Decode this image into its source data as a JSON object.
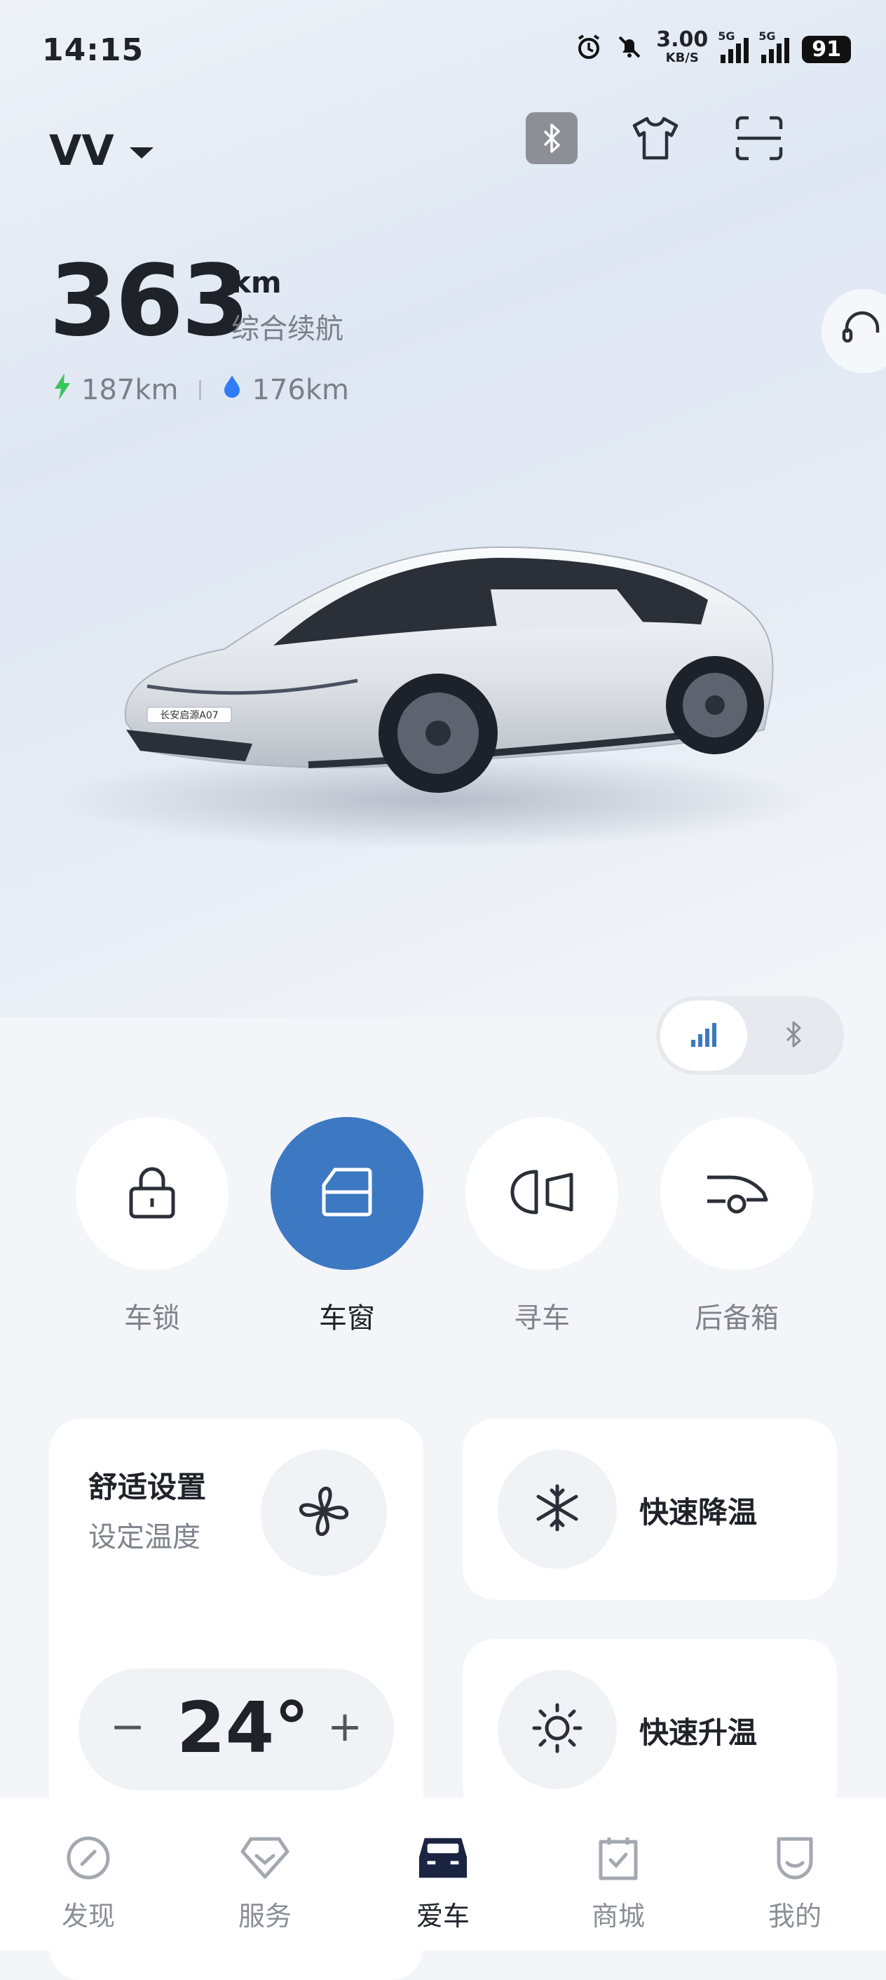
{
  "status_bar": {
    "time": "14:15",
    "net_rate": "3.00",
    "net_unit": "KB/S",
    "sim1": "5G",
    "sim2": "5G",
    "battery": "91"
  },
  "header": {
    "vehicle_name": "VV",
    "icons": [
      "bluetooth-icon",
      "shirt-icon",
      "scan-icon"
    ]
  },
  "range": {
    "value": "363",
    "unit": "km",
    "label": "综合续航",
    "electric": "187km",
    "fuel": "176km"
  },
  "car_image": {
    "plate_text": "长安启源A07"
  },
  "controls": [
    {
      "label": "车锁",
      "icon": "lock-icon",
      "active": false
    },
    {
      "label": "车窗",
      "icon": "window-icon",
      "active": true
    },
    {
      "label": "寻车",
      "icon": "headlight-icon",
      "active": false
    },
    {
      "label": "后备箱",
      "icon": "trunk-icon",
      "active": false
    }
  ],
  "comfort": {
    "title": "舒适设置",
    "subtitle": "设定温度",
    "minus": "−",
    "temperature": "24°",
    "plus": "+"
  },
  "quick_cool": {
    "label": "快速降温"
  },
  "quick_heat": {
    "label": "快速升温"
  },
  "tabs": [
    {
      "label": "发现",
      "icon": "discover-icon"
    },
    {
      "label": "服务",
      "icon": "service-icon"
    },
    {
      "label": "爱车",
      "icon": "car-icon",
      "active": true
    },
    {
      "label": "商城",
      "icon": "mall-icon"
    },
    {
      "label": "我的",
      "icon": "profile-icon"
    }
  ],
  "colors": {
    "accent": "#3d78c2",
    "electric": "#34c759",
    "fuel": "#2f7cf6"
  }
}
